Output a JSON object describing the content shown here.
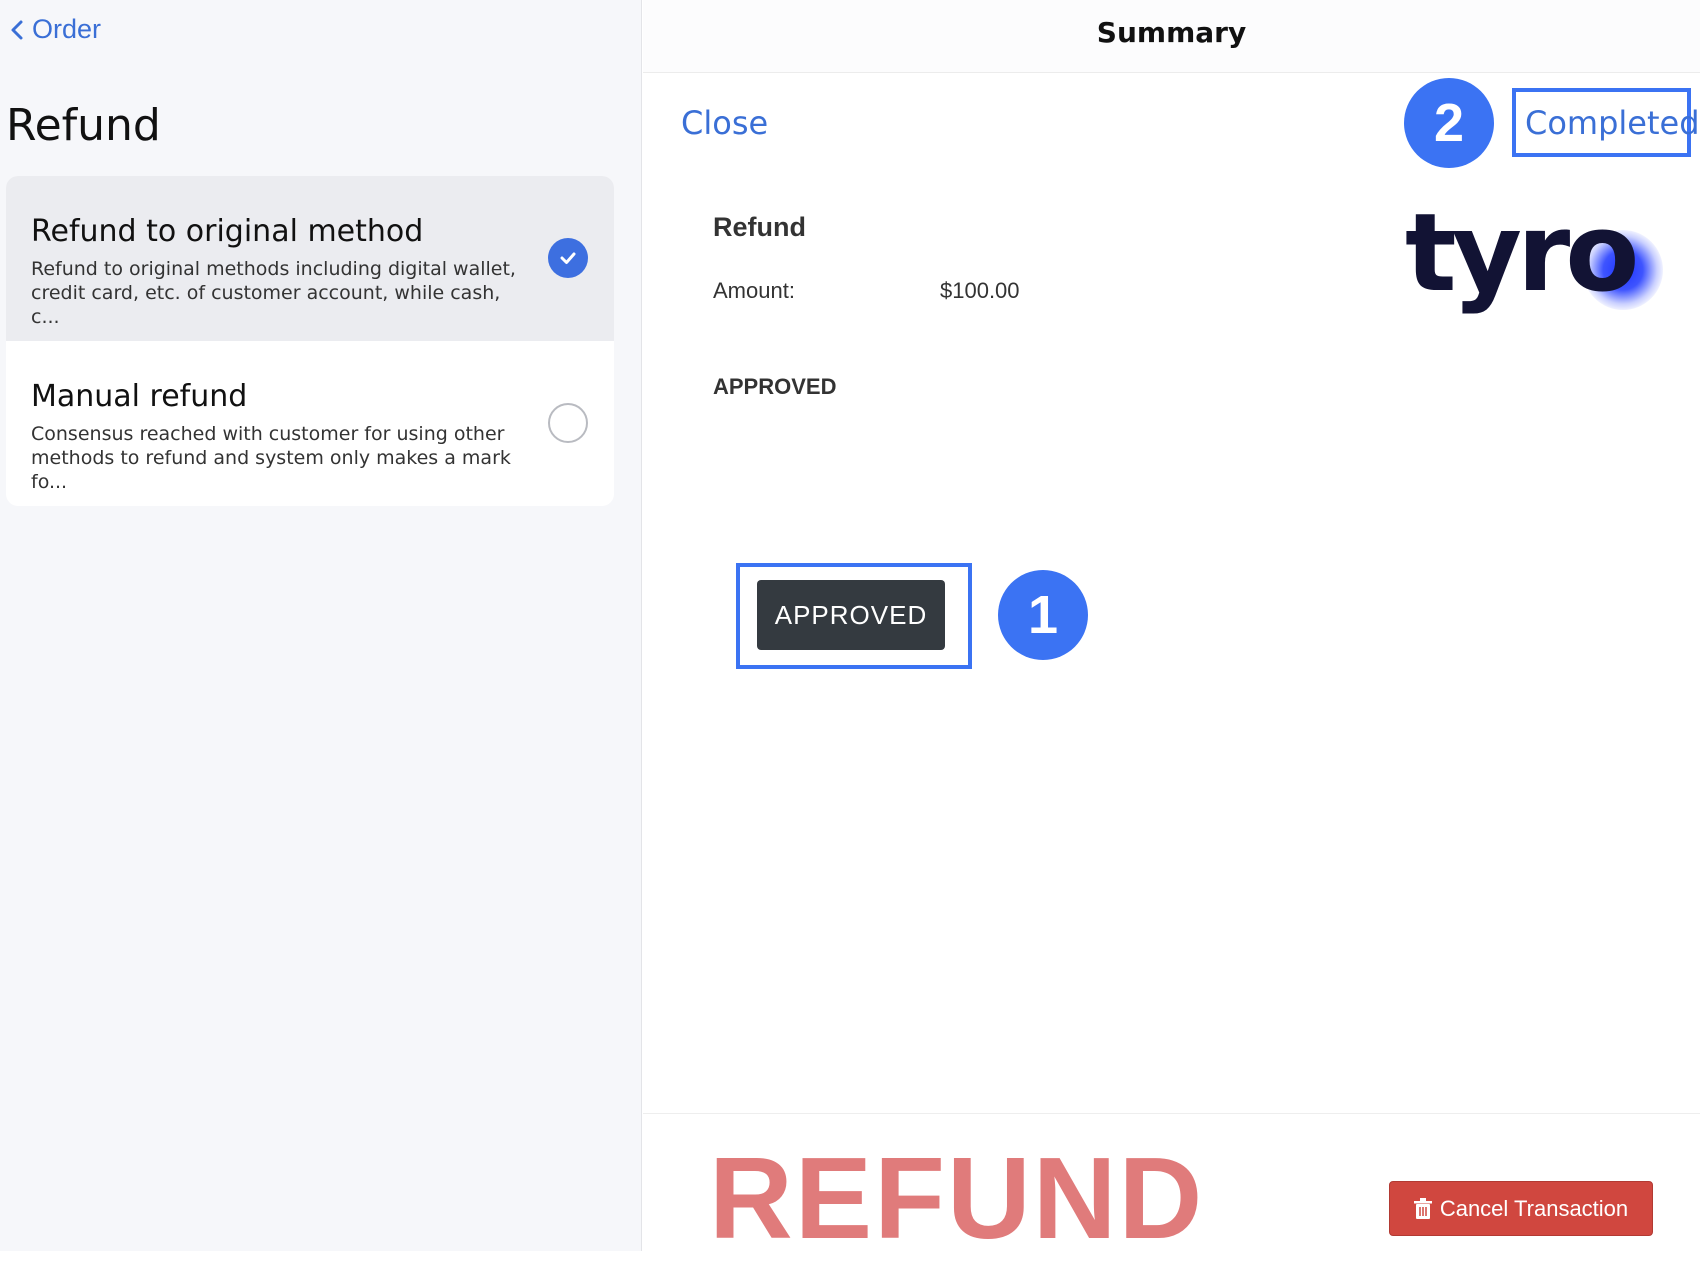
{
  "left_panel": {
    "back_label": "Order",
    "title": "Refund",
    "options": [
      {
        "title": "Refund to original method",
        "description": "Refund to original methods including digital wallet,\ncredit card, etc. of customer account, while cash, c...",
        "selected": true
      },
      {
        "title": "Manual refund",
        "description": "Consensus reached with customer for using other\nmethods to refund and system only makes a mark fo...",
        "selected": false
      }
    ]
  },
  "right_panel": {
    "title": "Summary",
    "close_label": "Close",
    "completed_label": "Completed",
    "receipt": {
      "heading": "Refund",
      "amount_label": "Amount:",
      "amount_value": "$100.00",
      "status": "APPROVED"
    },
    "logo_text": "tyro",
    "approved_button": "APPROVED",
    "banner": "REFUND",
    "cancel_button": "Cancel Transaction"
  },
  "markers": [
    "1",
    "2"
  ],
  "colors": {
    "accent_blue": "#3a6fd6",
    "marker_blue": "#3b73f3",
    "banner_red": "#e07b7b",
    "cancel_red": "#d0473f",
    "approved_dark": "#343a40"
  }
}
